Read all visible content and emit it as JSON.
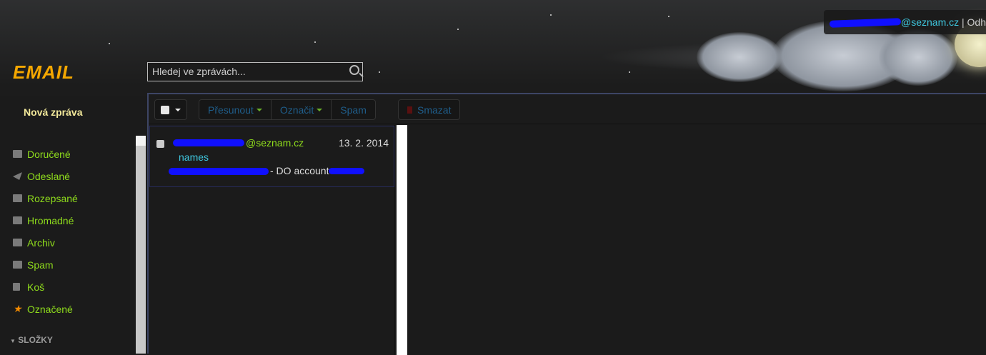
{
  "header": {
    "user_email_suffix": "@seznam.cz",
    "separator": "|",
    "logout_label": "Odh"
  },
  "logo": {
    "text": "EMAIL"
  },
  "search": {
    "placeholder": "Hledej ve zprávách..."
  },
  "sidebar": {
    "new_message": "Nová zpráva",
    "items": [
      {
        "label": "Doručené",
        "icon": "envelope-icon"
      },
      {
        "label": "Odeslané",
        "icon": "paper-plane-icon"
      },
      {
        "label": "Rozepsané",
        "icon": "edit-icon"
      },
      {
        "label": "Hromadné",
        "icon": "folder-icon"
      },
      {
        "label": "Archiv",
        "icon": "archive-icon"
      },
      {
        "label": "Spam",
        "icon": "spam-folder-icon"
      },
      {
        "label": "Koš",
        "icon": "trash-icon"
      },
      {
        "label": "Označené",
        "icon": "star-icon"
      }
    ],
    "folders_label": "SLOŽKY"
  },
  "toolbar": {
    "move": "Přesunout",
    "mark": "Označit",
    "spam": "Spam",
    "delete": "Smazat"
  },
  "messages": [
    {
      "sender_suffix": "@seznam.cz",
      "date": "13. 2. 2014",
      "tag": "names",
      "subject_fragment": "- DO account"
    }
  ],
  "colors": {
    "accent": "#8fdc1c",
    "link": "#3fc7df",
    "logo": "#f5a700"
  }
}
